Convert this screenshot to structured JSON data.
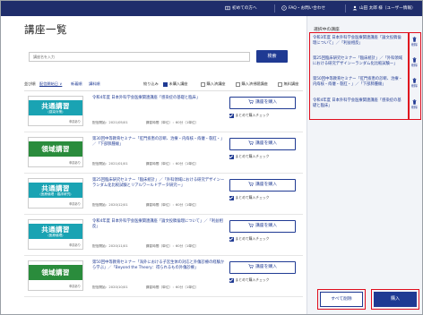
{
  "header": {
    "first_time": "初めての方へ",
    "faq": "FAQ・お問い合わせ",
    "user": "山田 太郎 様（ユーザー情報）"
  },
  "page": {
    "title": "講座一覧"
  },
  "search": {
    "placeholder": "講座名を入力",
    "button": "検索"
  },
  "sort": {
    "label": "並び順",
    "options": [
      "配信開始日 ∨",
      "新着順",
      "講料順"
    ]
  },
  "filter": {
    "label": "絞り込み",
    "options": [
      {
        "label": "未購入講座",
        "checked": true
      },
      {
        "label": "購入済講座",
        "checked": false
      },
      {
        "label": "購入済視聴講座",
        "checked": false
      },
      {
        "label": "無料講座",
        "checked": false
      }
    ]
  },
  "courses": [
    {
      "thumb_main": "共通講習",
      "thumb_sub": "(感染対策)",
      "thumb_color": "#1aa3b3",
      "title": "令和4年度 日本外科学会医療関連講座「感染症の基礎と臨床」",
      "date": "配信開始：2021/05/01",
      "duration_label": "講習時間（単位）：",
      "duration": "60分（1単位）",
      "buy": "講座を購入",
      "bulk": "まとめて購入チェック"
    },
    {
      "thumb_main": "領域講習",
      "thumb_sub": "",
      "thumb_color": "#2a8c3c",
      "title": "第30回中等教育セミナー「肛門疾患の診断、治療・内痔核・痔瘻・裂肛・」／「下部肺腫瘍」",
      "date": "配信開始：2021/01/01",
      "duration_label": "講習時間（単位）：",
      "duration": "60分（1単位）",
      "buy": "講座を購入",
      "bulk": "まとめて購入チェック"
    },
    {
      "thumb_main": "共通講習",
      "thumb_sub": "(医療倫理・臨床研究)",
      "thumb_color": "#1aa3b3",
      "title": "第25回臨床研究セミナー「臨床統計」／「外科領域における研究デザインーランダム化比較試験とリアルワールドデータ研究ー」",
      "date": "配信開始：2020/12/01",
      "duration_label": "講習時間（単位）：",
      "duration": "60分（1単位）",
      "buy": "講座を購入",
      "bulk": "まとめて購入チェック"
    },
    {
      "thumb_main": "共通講習",
      "thumb_sub": "(医療倫理)",
      "thumb_color": "#1aa3b3",
      "title": "令和4年度 日本外科学会医療関連講座「論文投稿倫理について」／「利益相反」",
      "date": "配信開始：2020/11/01",
      "duration_label": "講習時間（単位）：",
      "duration": "60分（1単位）",
      "buy": "講座を購入",
      "bulk": "まとめて購入チェック"
    },
    {
      "thumb_main": "領域講習",
      "thumb_sub": "",
      "thumb_color": "#2a8c3c",
      "title": "第50回中等教育セミナー「海外における子宮生体の対応と外傷診療の経験から学ぶ」／「Beyond the Theory：得られるもの外傷診療」",
      "date": "配信開始：2020/10/01",
      "duration_label": "講習時間（単位）：",
      "duration": "60分（1単位）",
      "buy": "講座を購入",
      "bulk": "まとめて購入チェック"
    }
  ],
  "thumb_badge": "申請あり",
  "cart": {
    "title": "選択中の講座",
    "items": [
      "令和3年度 日本外科学会医療関連講座「論文投稿倫理について」／「利益相反」",
      "第25回臨床研究セミナー「臨床統計」／「外科領域における研究デザインーランダム化比較試験ー」",
      "第50回中等教育セミナー「肛門疾患の診断、治療・内痔核・痔瘻・裂肛・」／「下部肺腫瘍」",
      "令和4年度 日本外科学会医療関連講座「感染症の基礎と臨床」"
    ],
    "delete": "削除",
    "clear_all": "すべて削除",
    "checkout": "購入"
  },
  "colors": {
    "header": "#1f2d6b",
    "accent": "#1f3a93",
    "highlight": "#e00d1d"
  }
}
